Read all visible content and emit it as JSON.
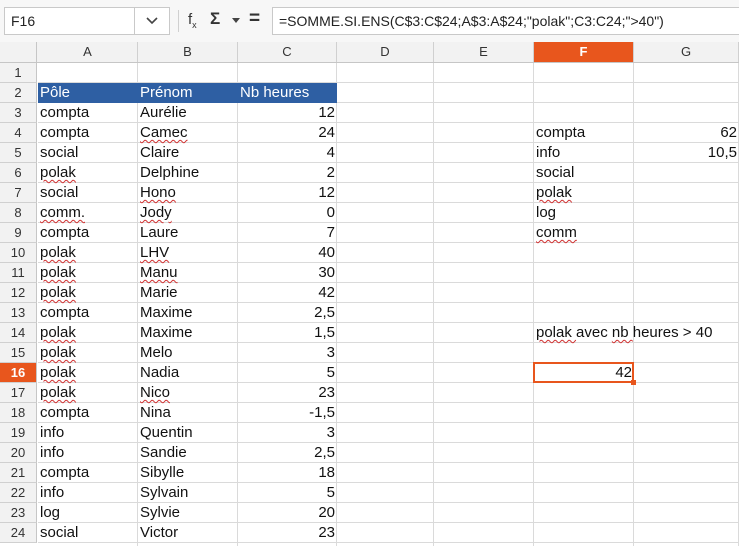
{
  "formula_bar": {
    "cell_reference": "F16",
    "formula": "=SOMME.SI.ENS(C$3:C$24;A$3:A$24;\"polak\";C3:C24;\">40\")",
    "fx_label": "f",
    "fx_sub": "x",
    "sigma_label": "Σ",
    "equal_label": "="
  },
  "columns": [
    "A",
    "B",
    "C",
    "D",
    "E",
    "F",
    "G"
  ],
  "selected_column": "F",
  "rows": [
    "1",
    "2",
    "3",
    "4",
    "5",
    "6",
    "7",
    "8",
    "9",
    "10",
    "11",
    "12",
    "13",
    "14",
    "15",
    "16",
    "17",
    "18",
    "19",
    "20",
    "21",
    "22",
    "23",
    "24"
  ],
  "selected_row": "16",
  "table": {
    "headers": [
      "Pôle",
      "Prénom",
      "Nb heures"
    ],
    "records": [
      {
        "pole": "compta",
        "prenom": "Aurélie",
        "heures": "12"
      },
      {
        "pole": "compta",
        "prenom": "Camec",
        "heures": "24"
      },
      {
        "pole": "social",
        "prenom": "Claire",
        "heures": "4"
      },
      {
        "pole": "polak",
        "prenom": "Delphine",
        "heures": "2"
      },
      {
        "pole": "social",
        "prenom": "Hono",
        "heures": "12"
      },
      {
        "pole": "comm.",
        "prenom": "Jody",
        "heures": "0"
      },
      {
        "pole": "compta",
        "prenom": "Laure",
        "heures": "7"
      },
      {
        "pole": "polak",
        "prenom": "LHV",
        "heures": "40"
      },
      {
        "pole": "polak",
        "prenom": "Manu",
        "heures": "30"
      },
      {
        "pole": "polak",
        "prenom": "Marie",
        "heures": "42"
      },
      {
        "pole": "compta",
        "prenom": "Maxime",
        "heures": "2,5"
      },
      {
        "pole": "polak",
        "prenom": "Maxime",
        "heures": "1,5"
      },
      {
        "pole": "polak",
        "prenom": "Melo",
        "heures": "3"
      },
      {
        "pole": "polak",
        "prenom": "Nadia",
        "heures": "5"
      },
      {
        "pole": "polak",
        "prenom": "Nico",
        "heures": "23"
      },
      {
        "pole": "compta",
        "prenom": "Nina",
        "heures": "-1,5"
      },
      {
        "pole": "info",
        "prenom": "Quentin",
        "heures": "3"
      },
      {
        "pole": "info",
        "prenom": "Sandie",
        "heures": "2,5"
      },
      {
        "pole": "compta",
        "prenom": "Sibylle",
        "heures": "18"
      },
      {
        "pole": "info",
        "prenom": "Sylvain",
        "heures": "5"
      },
      {
        "pole": "log",
        "prenom": "Sylvie",
        "heures": "20"
      },
      {
        "pole": "social",
        "prenom": "Victor",
        "heures": "23"
      }
    ]
  },
  "summary": [
    {
      "label": "compta",
      "value": "62"
    },
    {
      "label": "info",
      "value": "10,5"
    },
    {
      "label": "social",
      "value": ""
    },
    {
      "label": "polak",
      "value": ""
    },
    {
      "label": "log",
      "value": ""
    },
    {
      "label": "comm",
      "value": ""
    }
  ],
  "criteria_label": "polak avec nb heures > 40",
  "result_value": "42",
  "colors": {
    "header_fill": "#2e5fa3",
    "selection": "#e8561d",
    "spell_underline": "#d03030"
  }
}
